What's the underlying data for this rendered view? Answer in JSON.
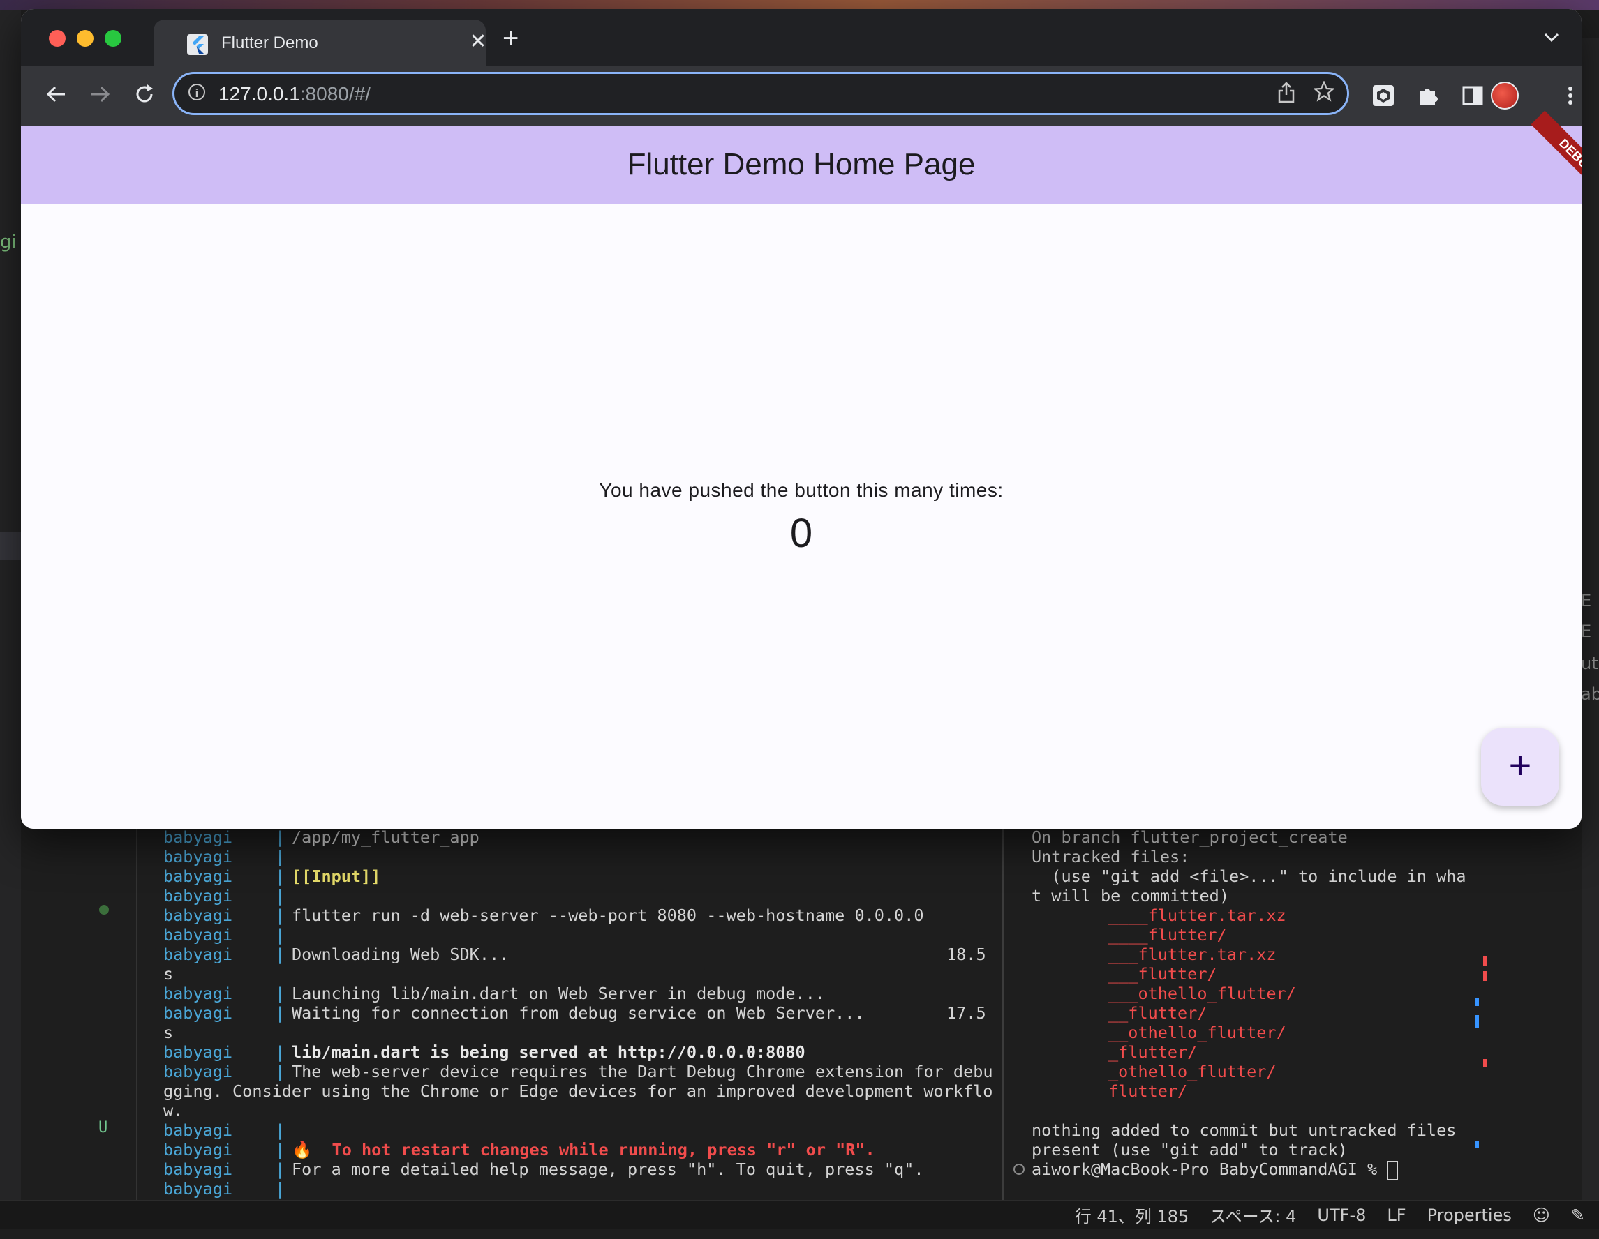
{
  "browser": {
    "tab_title": "Flutter Demo",
    "url_host": "127.0.0.1",
    "url_rest": ":8080/#/",
    "new_tab": "+",
    "tab_close": "✕"
  },
  "app": {
    "title": "Flutter Demo Home Page",
    "debug_label": "DEBUG",
    "counter_label": "You have pushed the button this many times:",
    "counter_value": "0",
    "fab_label": "+"
  },
  "terminal_left": {
    "lines": [
      {
        "name": "babyagi",
        "msg": "/app/my_flutter_app"
      },
      {
        "name": "babyagi",
        "msg": ""
      },
      {
        "name": "babyagi",
        "msg": "[[Input]]"
      },
      {
        "name": "babyagi",
        "msg": ""
      },
      {
        "name": "babyagi",
        "msg": "flutter run -d web-server --web-port 8080 --web-hostname 0.0.0.0"
      },
      {
        "name": "babyagi",
        "msg": ""
      },
      {
        "name": "babyagi",
        "msg": "Downloading Web SDK...",
        "time": "18.5"
      },
      {
        "cont": "s"
      },
      {
        "name": "babyagi",
        "msg": "Launching lib/main.dart on Web Server in debug mode..."
      },
      {
        "name": "babyagi",
        "msg": "Waiting for connection from debug service on Web Server...",
        "time": "17.5"
      },
      {
        "cont": "s"
      },
      {
        "name": "babyagi",
        "msg": "lib/main.dart is being served at http://0.0.0.0:8080"
      },
      {
        "name": "babyagi",
        "msg": "The web-server device requires the Dart Debug Chrome extension for debu"
      },
      {
        "cont": "gging. Consider using the Chrome or Edge devices for an improved development workflo"
      },
      {
        "cont": "w."
      },
      {
        "name": "babyagi",
        "msg": ""
      },
      {
        "name": "babyagi",
        "msg": "🔥  To hot restart changes while running, press \"r\" or \"R\"."
      },
      {
        "name": "babyagi",
        "msg": "For a more detailed help message, press \"h\". To quit, press \"q\"."
      },
      {
        "name": "babyagi",
        "msg": ""
      }
    ]
  },
  "terminal_right": {
    "lines": [
      "On branch flutter_project_create",
      "Untracked files:",
      "  (use \"git add <file>...\" to include in wha",
      "t will be committed)"
    ],
    "untracked": [
      "____flutter.tar.xz",
      "____flutter/",
      "___flutter.tar.xz",
      "___flutter/",
      "___othello_flutter/",
      "__flutter/",
      "__othello_flutter/",
      "_flutter/",
      "_othello_flutter/",
      "flutter/"
    ],
    "footer": [
      "nothing added to commit but untracked files",
      "present (use \"git add\" to track)"
    ],
    "prompt": "aiwork@MacBook-Pro BabyCommandAGI % "
  },
  "ide": {
    "left_fragment": "gi",
    "git_status": "U",
    "right_fragments": [
      "E",
      "E",
      "utc",
      "abl"
    ]
  },
  "statusbar": {
    "position": "行 41、列 185",
    "spaces": "スペース: 4",
    "encoding": "UTF-8",
    "eol": "LF",
    "language": "Properties"
  },
  "colors": {
    "appbar": "#cfbdf6",
    "fab": "#ebe2fb",
    "debug_banner": "#a71c1c",
    "omnibox_focus": "#8ab4f8"
  }
}
